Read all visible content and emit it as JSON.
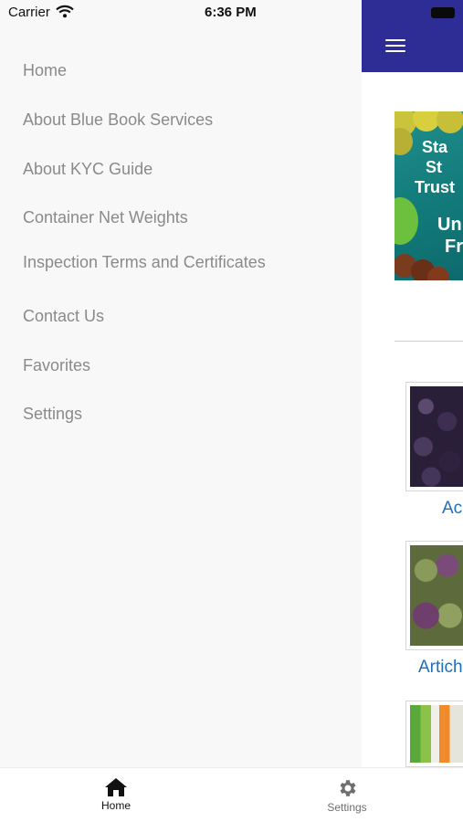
{
  "status_bar": {
    "carrier": "Carrier",
    "time": "6:36 PM"
  },
  "drawer": {
    "items": [
      {
        "label": "Home"
      },
      {
        "label": "About Blue Book Services"
      },
      {
        "label": "About KYC Guide"
      },
      {
        "label": "Container Net Weights"
      },
      {
        "label": "Inspection Terms and Certificates"
      },
      {
        "label": "Contact Us"
      },
      {
        "label": "Favorites"
      },
      {
        "label": "Settings"
      }
    ]
  },
  "app": {
    "header_color": "#2e2d95",
    "banner": {
      "line1": "Sta",
      "line2": "St",
      "line3": "Trust",
      "line4": "Un",
      "line5": "Fr"
    },
    "products": [
      {
        "label": "Ac"
      },
      {
        "label": "Artich"
      },
      {
        "label": ""
      }
    ]
  },
  "tabbar": {
    "tabs": [
      {
        "label": "Home",
        "icon": "home-icon",
        "active": true
      },
      {
        "label": "Settings",
        "icon": "gear-icon",
        "active": false
      }
    ]
  }
}
